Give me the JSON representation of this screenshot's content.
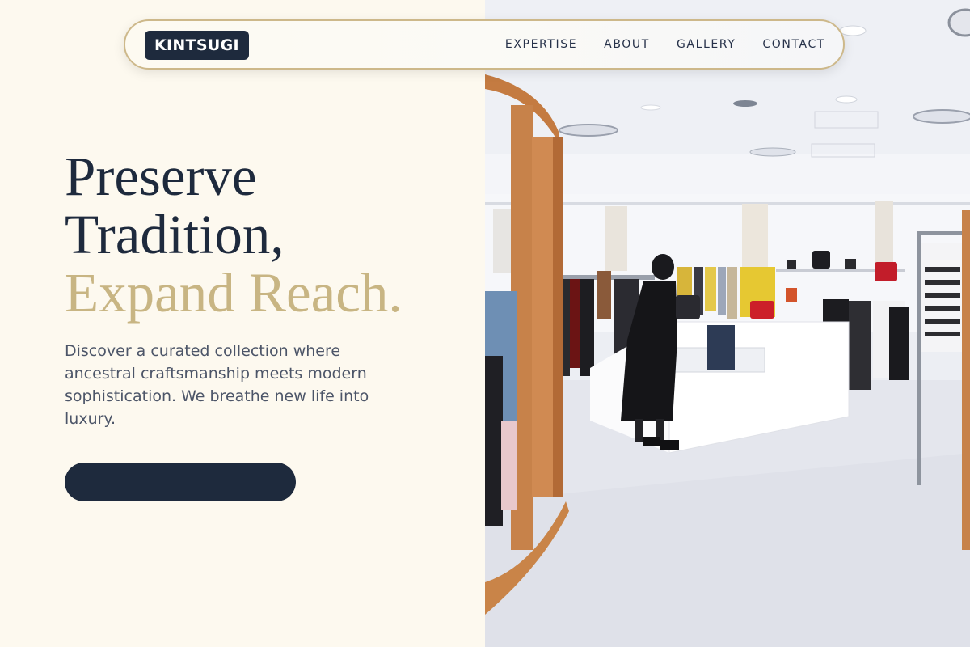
{
  "brand": {
    "logo_text": "KINTSUGI"
  },
  "nav": {
    "links": [
      "EXPERTISE",
      "ABOUT",
      "GALLERY",
      "CONTACT"
    ]
  },
  "hero": {
    "headline_line1": "Preserve",
    "headline_line2": "Tradition,",
    "headline_accent": "Expand Reach.",
    "subtext": "Discover a curated collection where ancestral craftsmanship meets modern sophistication. We breathe new life into luxury.",
    "cta_label": ""
  },
  "colors": {
    "background": "#fdf9ef",
    "navy": "#1e2a3d",
    "gold": "#c8b583",
    "nav_border": "#cdb88a"
  },
  "image": {
    "icon": "boutique-interior-photo"
  }
}
